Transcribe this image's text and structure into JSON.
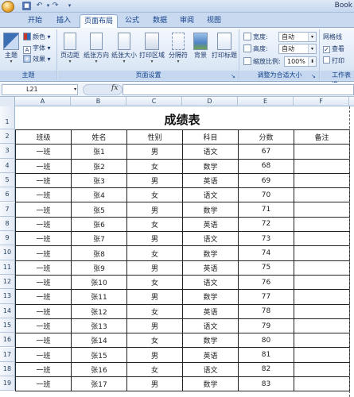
{
  "app_title": "Book",
  "tabs": [
    "开始",
    "插入",
    "页面布局",
    "公式",
    "数据",
    "审阅",
    "视图"
  ],
  "active_tab": "页面布局",
  "ribbon": {
    "theme_group": {
      "label": "主题",
      "big_button": "主题",
      "colors": "颜色",
      "fonts": "字体",
      "effects": "效果"
    },
    "page_setup_group": {
      "label": "页面设置",
      "buttons": [
        "页边距",
        "纸张方向",
        "纸张大小",
        "打印区域",
        "分隔符",
        "背景",
        "打印标题"
      ]
    },
    "scale_group": {
      "label": "调整为合适大小",
      "width_label": "宽度:",
      "width_value": "自动",
      "height_label": "高度:",
      "height_value": "自动",
      "scale_label": "缩放比例:",
      "scale_value": "100%"
    },
    "sheet_options_group": {
      "label": "工作表选",
      "gridlines": "网格线",
      "view": "查看",
      "print": "打印"
    }
  },
  "formula_bar": {
    "name_box": "L21",
    "fx": "fx",
    "formula": ""
  },
  "columns": [
    "A",
    "B",
    "C",
    "D",
    "E",
    "F"
  ],
  "rows": [
    "1",
    "2",
    "3",
    "4",
    "5",
    "6",
    "7",
    "8",
    "9",
    "10",
    "11",
    "12",
    "13",
    "14",
    "15",
    "16",
    "17",
    "18",
    "19"
  ],
  "sheet_title": "成绩表",
  "table": {
    "headers": [
      "班级",
      "姓名",
      "性别",
      "科目",
      "分数",
      "备注"
    ],
    "rows": [
      [
        "一班",
        "张1",
        "男",
        "语文",
        "67",
        ""
      ],
      [
        "一班",
        "张2",
        "女",
        "数学",
        "68",
        ""
      ],
      [
        "一班",
        "张3",
        "男",
        "英语",
        "69",
        ""
      ],
      [
        "一班",
        "张4",
        "女",
        "语文",
        "70",
        ""
      ],
      [
        "一班",
        "张5",
        "男",
        "数学",
        "71",
        ""
      ],
      [
        "一班",
        "张6",
        "女",
        "英语",
        "72",
        ""
      ],
      [
        "一班",
        "张7",
        "男",
        "语文",
        "73",
        ""
      ],
      [
        "一班",
        "张8",
        "女",
        "数学",
        "74",
        ""
      ],
      [
        "一班",
        "张9",
        "男",
        "英语",
        "75",
        ""
      ],
      [
        "一班",
        "张10",
        "女",
        "语文",
        "76",
        ""
      ],
      [
        "一班",
        "张11",
        "男",
        "数学",
        "77",
        ""
      ],
      [
        "一班",
        "张12",
        "女",
        "英语",
        "78",
        ""
      ],
      [
        "一班",
        "张13",
        "男",
        "语文",
        "79",
        ""
      ],
      [
        "一班",
        "张14",
        "女",
        "数学",
        "80",
        ""
      ],
      [
        "一班",
        "张15",
        "男",
        "英语",
        "81",
        ""
      ],
      [
        "一班",
        "张16",
        "女",
        "语文",
        "82",
        ""
      ],
      [
        "一班",
        "张17",
        "男",
        "数学",
        "83",
        ""
      ]
    ]
  },
  "colors": {
    "ribbon_text": "#15428b",
    "active_tab_bg": "#fbfcfe",
    "grid_border": "#222222"
  }
}
